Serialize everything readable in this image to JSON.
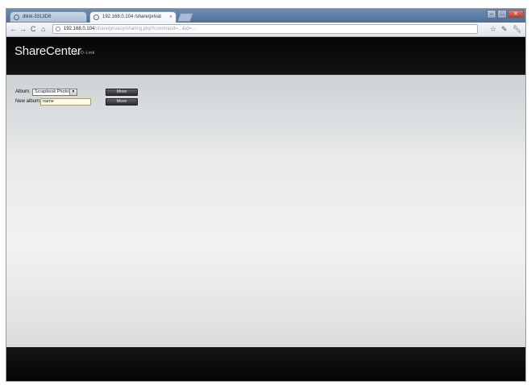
{
  "browser": {
    "tabs": [
      {
        "label": "dlink-3313D8",
        "active": false
      },
      {
        "label": "192.168.0.104 /share/privat",
        "active": true
      }
    ],
    "tab_close": "×",
    "window_buttons": {
      "minimize": "–",
      "maximize": "□",
      "close": "✕"
    },
    "nav": {
      "back": "←",
      "forward": "→",
      "reload": "C",
      "home": "⌂"
    },
    "url_host": "192.168.0.104",
    "url_path": "/share/privacy/sharing.php?command=...&id=...",
    "tool_icons": {
      "star": "☆",
      "wrench": "✎"
    }
  },
  "app": {
    "brand": "ShareCenter",
    "brand_sub": "by D-Link"
  },
  "form": {
    "album_label": "Album:",
    "album_selected": "Scrapbook Photos",
    "album_chevron": "▼",
    "new_album_label": "New album:",
    "new_album_value": "name",
    "button1_label": "Move",
    "button2_label": "Move"
  },
  "colors": {
    "header_bg": "#080808",
    "tab_strip": "#5a7ba3",
    "input_bg": "#fffbe4",
    "button_bg": "#3a3d42"
  }
}
